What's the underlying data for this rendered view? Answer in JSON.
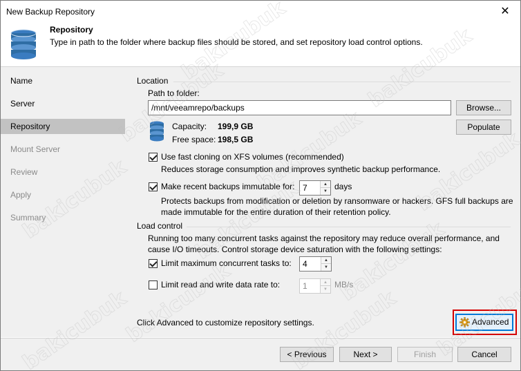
{
  "window": {
    "title": "New Backup Repository",
    "close_glyph": "✕"
  },
  "header": {
    "title": "Repository",
    "description": "Type in path to the folder where backup files should be stored, and set repository load control options.",
    "icon": "database-icon"
  },
  "nav": {
    "items": [
      {
        "label": "Name",
        "state": "normal"
      },
      {
        "label": "Server",
        "state": "normal"
      },
      {
        "label": "Repository",
        "state": "active"
      },
      {
        "label": "Mount Server",
        "state": "disabled"
      },
      {
        "label": "Review",
        "state": "disabled"
      },
      {
        "label": "Apply",
        "state": "disabled"
      },
      {
        "label": "Summary",
        "state": "disabled"
      }
    ]
  },
  "location": {
    "section_title": "Location",
    "path_label": "Path to folder:",
    "path_value": "/mnt/veeamrepo/backups",
    "browse_label": "Browse...",
    "populate_label": "Populate",
    "capacity_label": "Capacity:",
    "capacity_value": "199,9 GB",
    "free_space_label": "Free space:",
    "free_space_value": "198,5 GB",
    "fast_cloning": {
      "checked": true,
      "label": "Use fast cloning on XFS volumes (recommended)",
      "description": "Reduces storage consumption and improves synthetic backup performance."
    },
    "immutable": {
      "checked": true,
      "label": "Make recent backups immutable for:",
      "value": "7",
      "unit": "days",
      "description_line1": "Protects backups from modification or deletion by ransomware or hackers. GFS full backups are",
      "description_line2": "made immutable for the entire duration of their retention policy."
    }
  },
  "load_control": {
    "section_title": "Load control",
    "description_line1": "Running too many concurrent tasks against the repository may reduce overall performance, and",
    "description_line2": "cause I/O timeouts. Control storage device saturation with the following settings:",
    "limit_tasks": {
      "checked": true,
      "label": "Limit maximum concurrent tasks to:",
      "value": "4"
    },
    "limit_rate": {
      "checked": false,
      "label": "Limit read and write data rate to:",
      "value": "1",
      "unit": "MB/s"
    }
  },
  "advanced": {
    "hint": "Click Advanced to customize repository settings.",
    "button_label": "Advanced"
  },
  "footer": {
    "previous_label": "< Previous",
    "next_label": "Next >",
    "finish_label": "Finish",
    "cancel_label": "Cancel"
  },
  "watermark": {
    "text": "bakicubuk"
  },
  "colors": {
    "panel_bg": "#f0f0f0",
    "active_nav": "#c2c2c2",
    "highlight_border": "#d40000",
    "focus_blue": "#0078d7",
    "db_icon_blue": "#2e6da4"
  }
}
